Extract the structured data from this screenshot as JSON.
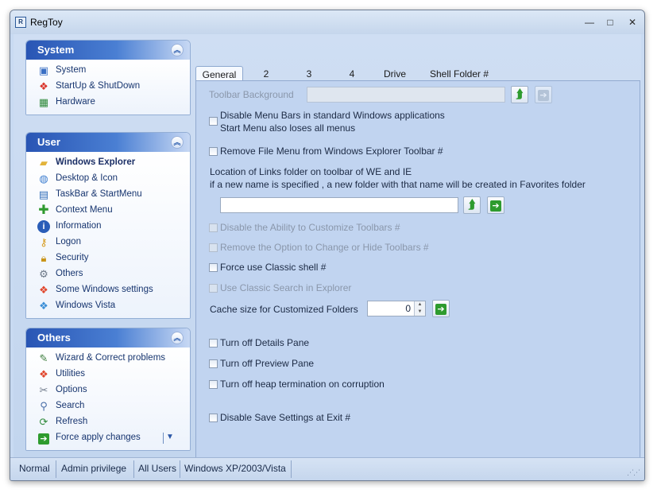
{
  "window": {
    "title": "RegToy",
    "app_icon_text": "R",
    "controls": {
      "minimize": "—",
      "maximize": "□",
      "close": "✕"
    }
  },
  "sidebar": {
    "system": {
      "title": "System",
      "items": [
        {
          "label": "System",
          "icon": "computer-icon"
        },
        {
          "label": "StartUp & ShutDown",
          "icon": "windows-flag-icon"
        },
        {
          "label": "Hardware",
          "icon": "chip-icon"
        }
      ]
    },
    "user": {
      "title": "User",
      "items": [
        {
          "label": "Windows Explorer",
          "icon": "folder-icon"
        },
        {
          "label": "Desktop & Icon",
          "icon": "desktop-icon"
        },
        {
          "label": "TaskBar & StartMenu",
          "icon": "taskbar-icon"
        },
        {
          "label": "Context Menu",
          "icon": "plus-icon"
        },
        {
          "label": "Information",
          "icon": "info-icon"
        },
        {
          "label": "Logon",
          "icon": "key-icon"
        },
        {
          "label": "Security",
          "icon": "lock-icon"
        },
        {
          "label": "Others",
          "icon": "gear-icon"
        },
        {
          "label": "Some Windows settings",
          "icon": "windows-logo-icon"
        },
        {
          "label": "Windows Vista",
          "icon": "windows-logo-icon"
        }
      ]
    },
    "others": {
      "title": "Others",
      "items": [
        {
          "label": "Wizard & Correct problems",
          "icon": "wizard-icon"
        },
        {
          "label": "Utilities",
          "icon": "windows-logo-icon"
        },
        {
          "label": "Options",
          "icon": "tools-icon"
        },
        {
          "label": "Search",
          "icon": "search-icon"
        },
        {
          "label": "Refresh",
          "icon": "refresh-icon"
        },
        {
          "label": "Force apply changes",
          "icon": "green-arrow-icon"
        }
      ],
      "dropdown_glyph": "▼"
    }
  },
  "tabs": [
    {
      "label": "General",
      "active": true
    },
    {
      "label": "2"
    },
    {
      "label": "3"
    },
    {
      "label": "4"
    },
    {
      "label": "Drive"
    },
    {
      "label": "Shell Folder #"
    }
  ],
  "general": {
    "toolbar_background_label": "Toolbar Background",
    "toolbar_background_value": "",
    "opt_disable_menu_bars": {
      "line1": "Disable Menu  Bars in standard Windows applications",
      "line2": "Start Menu also loses all menus",
      "checked": false
    },
    "opt_remove_file_menu": {
      "label": "Remove File Menu from Windows Explorer Toolbar #",
      "checked": false
    },
    "links_folder": {
      "line1": "Location of Links folder on toolbar of WE and IE",
      "line2": "if a new name is specified , a new folder with that name will be created in Favorites folder",
      "value": ""
    },
    "opt_disable_customize": {
      "label": "Disable the Ability to Customize Toolbars #",
      "checked": false,
      "enabled": false
    },
    "opt_remove_change_hide": {
      "label": "Remove the Option to Change or Hide Toolbars #",
      "checked": false,
      "enabled": false
    },
    "opt_force_classic": {
      "label": "Force use Classic shell #",
      "checked": false
    },
    "opt_classic_search": {
      "label": "Use Classic Search in Explorer",
      "checked": false,
      "enabled": false
    },
    "cache_size": {
      "label": "Cache size for Customized Folders",
      "value": "0"
    },
    "opt_details_pane": {
      "label": "Turn off Details Pane",
      "checked": false
    },
    "opt_preview_pane": {
      "label": "Turn off Preview Pane",
      "checked": false
    },
    "opt_heap_termination": {
      "label": "Turn off heap termination on corruption",
      "checked": false
    },
    "opt_disable_save": {
      "label": "Disable Save Settings at Exit #",
      "checked": false
    }
  },
  "statusbar": {
    "mode": "Normal",
    "privilege": "Admin privilege",
    "scope": "All Users",
    "os": "Windows XP/2003/Vista"
  }
}
